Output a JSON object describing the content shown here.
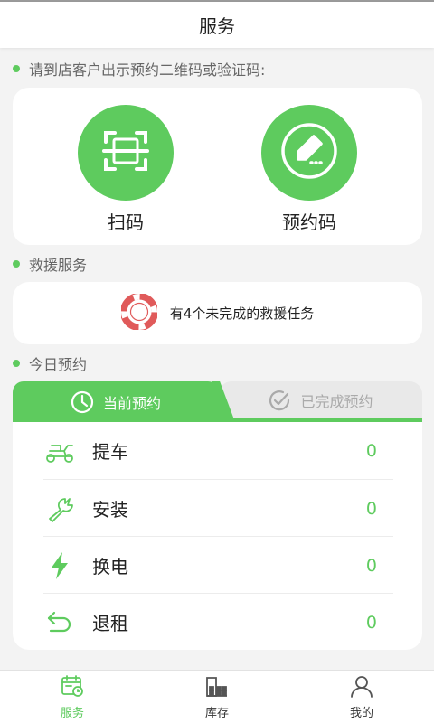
{
  "header": {
    "title": "服务"
  },
  "scan_section": {
    "label": "请到店客户出示预约二维码或验证码:",
    "items": [
      {
        "label": "扫码",
        "icon": "scan-icon"
      },
      {
        "label": "预约码",
        "icon": "edit-icon"
      }
    ]
  },
  "rescue_section": {
    "label": "救援服务",
    "message": "有4个未完成的救援任务",
    "icon": "lifebuoy-icon"
  },
  "today_section": {
    "label": "今日预约",
    "tabs": [
      {
        "label": "当前预约",
        "icon": "clock-icon",
        "active": true
      },
      {
        "label": "已完成预约",
        "icon": "check-circle-icon",
        "active": false
      }
    ],
    "rows": [
      {
        "name": "提车",
        "count": "0",
        "icon": "scooter-icon"
      },
      {
        "name": "安装",
        "count": "0",
        "icon": "wrench-icon"
      },
      {
        "name": "换电",
        "count": "0",
        "icon": "lightning-icon"
      },
      {
        "name": "退租",
        "count": "0",
        "icon": "return-arrow-icon"
      }
    ]
  },
  "bottom_nav": [
    {
      "label": "服务",
      "icon": "calendar-icon",
      "active": true
    },
    {
      "label": "库存",
      "icon": "warehouse-icon",
      "active": false
    },
    {
      "label": "我的",
      "icon": "user-icon",
      "active": false
    }
  ],
  "colors": {
    "accent": "#5ecb5e",
    "rescue_red": "#e05a5a",
    "background": "#f3f3f3"
  }
}
